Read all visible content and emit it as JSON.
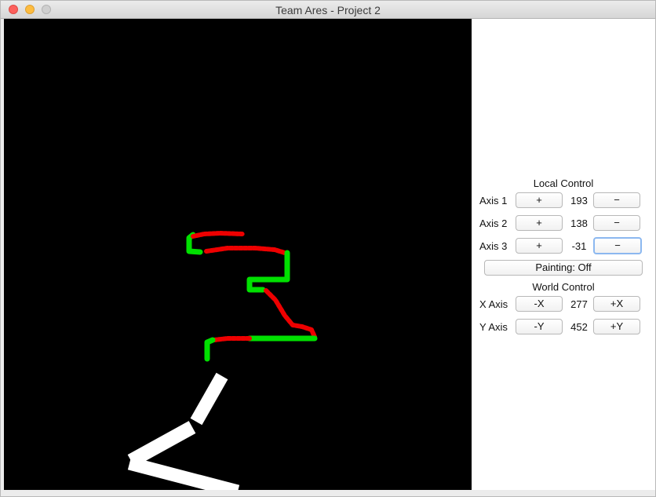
{
  "window": {
    "title": "Team Ares - Project 2"
  },
  "local_control": {
    "heading": "Local Control",
    "axes": [
      {
        "label": "Axis 1",
        "plus": "+",
        "value": "193",
        "minus": "−"
      },
      {
        "label": "Axis 2",
        "plus": "+",
        "value": "138",
        "minus": "−"
      },
      {
        "label": "Axis 3",
        "plus": "+",
        "value": "-31",
        "minus": "−"
      }
    ]
  },
  "painting": {
    "label": "Painting: Off"
  },
  "world_control": {
    "heading": "World Control",
    "axes": [
      {
        "label": "X Axis",
        "minus": "-X",
        "value": "277",
        "plus": "+X"
      },
      {
        "label": "Y Axis",
        "minus": "-Y",
        "value": "452",
        "plus": "+Y"
      }
    ]
  },
  "colors": {
    "canvas_background": "#000000",
    "arm_color": "#ffffff",
    "path_green": "#00e000",
    "path_red": "#ee0000"
  }
}
